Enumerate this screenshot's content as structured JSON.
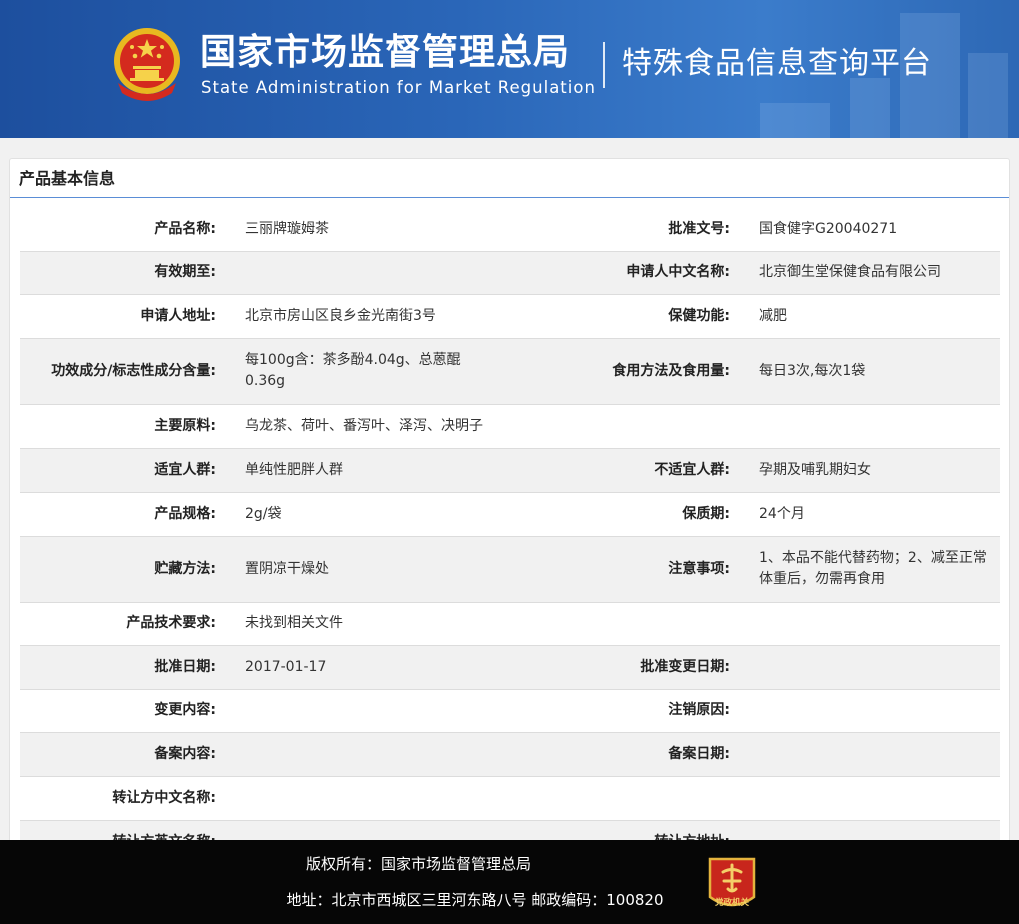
{
  "header": {
    "title_cn": "国家市场监督管理总局",
    "title_en": "State Administration  for  Market Regulation",
    "platform": "特殊食品信息查询平台"
  },
  "panel": {
    "title": "产品基本信息"
  },
  "rows": [
    {
      "label1": "产品名称:",
      "value1": "三丽牌璇姆茶",
      "label2": "批准文号:",
      "value2": "国食健字G20040271"
    },
    {
      "label1": "有效期至:",
      "value1": "",
      "label2": "申请人中文名称:",
      "value2": "北京御生堂保健食品有限公司"
    },
    {
      "label1": "申请人地址:",
      "value1": "北京市房山区良乡金光南街3号",
      "label2": "保健功能:",
      "value2": "减肥"
    },
    {
      "label1": "功效成分/标志性成分含量:",
      "value1": "每100g含：茶多酚4.04g、总蒽醌0.36g",
      "label2": "食用方法及食用量:",
      "value2": "每日3次,每次1袋"
    },
    {
      "label1": "主要原料:",
      "value1": "乌龙茶、荷叶、番泻叶、泽泻、决明子",
      "label2": "",
      "value2": ""
    },
    {
      "label1": "适宜人群:",
      "value1": "单纯性肥胖人群",
      "label2": "不适宜人群:",
      "value2": "孕期及哺乳期妇女"
    },
    {
      "label1": "产品规格:",
      "value1": "2g/袋",
      "label2": "保质期:",
      "value2": "24个月"
    },
    {
      "label1": "贮藏方法:",
      "value1": "置阴凉干燥处",
      "label2": "注意事项:",
      "value2": "1、本品不能代替药物；2、减至正常体重后，勿需再食用"
    },
    {
      "label1": "产品技术要求:",
      "value1": "未找到相关文件",
      "label2": "",
      "value2": ""
    },
    {
      "label1": "批准日期:",
      "value1": "2017-01-17",
      "label2": "批准变更日期:",
      "value2": ""
    },
    {
      "label1": "变更内容:",
      "value1": "",
      "label2": "注销原因:",
      "value2": ""
    },
    {
      "label1": "备案内容:",
      "value1": "",
      "label2": "备案日期:",
      "value2": ""
    },
    {
      "label1": "转让方中文名称:",
      "value1": "",
      "label2": "",
      "value2": ""
    },
    {
      "label1": "转让方英文名称:",
      "value1": "",
      "label2": "转让方地址:",
      "value2": ""
    }
  ],
  "footer": {
    "copyright": "版权所有：国家市场监督管理总局",
    "address": "地址：北京市西城区三里河东路八号 邮政编码：100820",
    "badge_text": "党政机关"
  }
}
